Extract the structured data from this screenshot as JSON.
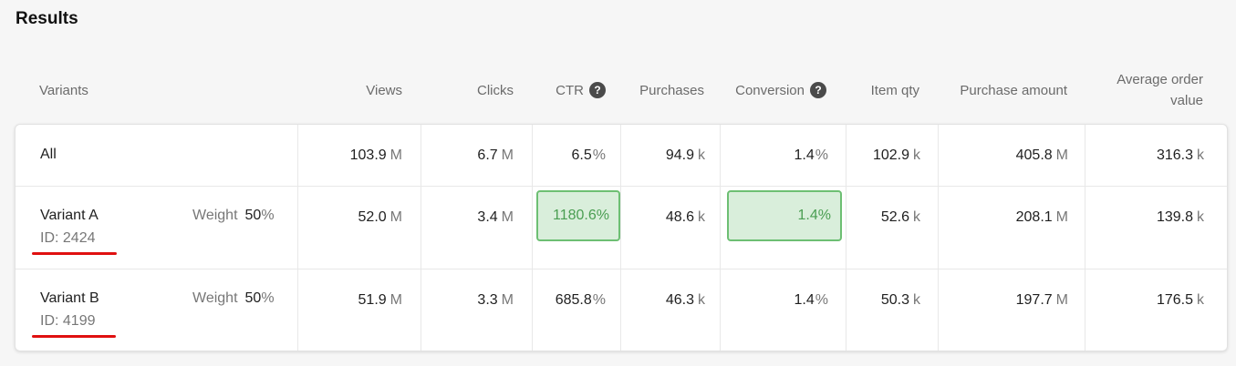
{
  "title": "Results",
  "colors": {
    "accent_green": "#4a9e52",
    "highlight_bg": "#d9eedb",
    "underline_red": "#e01010"
  },
  "headers": {
    "variants": "Variants",
    "views": "Views",
    "clicks": "Clicks",
    "ctr": "CTR",
    "purchases": "Purchases",
    "conversion": "Conversion",
    "item_qty": "Item qty",
    "purchase_amount": "Purchase amount",
    "aov_line1": "Average order",
    "aov_line2": "value",
    "help_glyph": "?"
  },
  "rows": [
    {
      "name": "All",
      "views": "103.9",
      "views_unit": "M",
      "clicks": "6.7",
      "clicks_unit": "M",
      "ctr": "6.5",
      "ctr_unit": "%",
      "purchases": "94.9",
      "purchases_unit": "k",
      "conversion": "1.4",
      "conversion_unit": "%",
      "item_qty": "102.9",
      "item_qty_unit": "k",
      "purchase_amount": "405.8",
      "purchase_amount_unit": "M",
      "aov": "316.3",
      "aov_unit": "k"
    },
    {
      "name": "Variant A",
      "id_label": "ID: 2424",
      "weight_label": "Weight",
      "weight": "50",
      "weight_unit": "%",
      "views": "52.0",
      "views_unit": "M",
      "clicks": "3.4",
      "clicks_unit": "M",
      "ctr": "1180.6%",
      "purchases": "48.6",
      "purchases_unit": "k",
      "conversion": "1.4%",
      "item_qty": "52.6",
      "item_qty_unit": "k",
      "purchase_amount": "208.1",
      "purchase_amount_unit": "M",
      "aov": "139.8",
      "aov_unit": "k"
    },
    {
      "name": "Variant B",
      "id_label": "ID: 4199",
      "weight_label": "Weight",
      "weight": "50",
      "weight_unit": "%",
      "views": "51.9",
      "views_unit": "M",
      "clicks": "3.3",
      "clicks_unit": "M",
      "ctr": "685.8",
      "ctr_unit": "%",
      "purchases": "46.3",
      "purchases_unit": "k",
      "conversion": "1.4",
      "conversion_unit": "%",
      "item_qty": "50.3",
      "item_qty_unit": "k",
      "purchase_amount": "197.7",
      "purchase_amount_unit": "M",
      "aov": "176.5",
      "aov_unit": "k"
    }
  ]
}
